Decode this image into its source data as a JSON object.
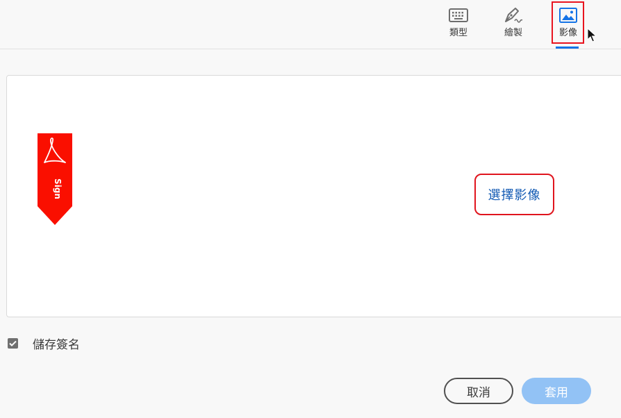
{
  "tabs": [
    {
      "id": "type",
      "label": "類型",
      "icon": "keyboard-icon"
    },
    {
      "id": "draw",
      "label": "繪製",
      "icon": "pen-nib-icon"
    },
    {
      "id": "image",
      "label": "影像",
      "icon": "image-icon",
      "selected": true
    }
  ],
  "pad": {
    "ribbon_text": "Sign",
    "select_image_label": "選擇影像"
  },
  "save_signature": {
    "label": "儲存簽名",
    "checked": true
  },
  "buttons": {
    "cancel": "取消",
    "apply": "套用"
  },
  "colors": {
    "accent": "#1473e6",
    "highlight": "#e8141f",
    "ribbon": "#fa0f00",
    "apply_disabled": "#92c2f5",
    "link": "#1159b3"
  }
}
